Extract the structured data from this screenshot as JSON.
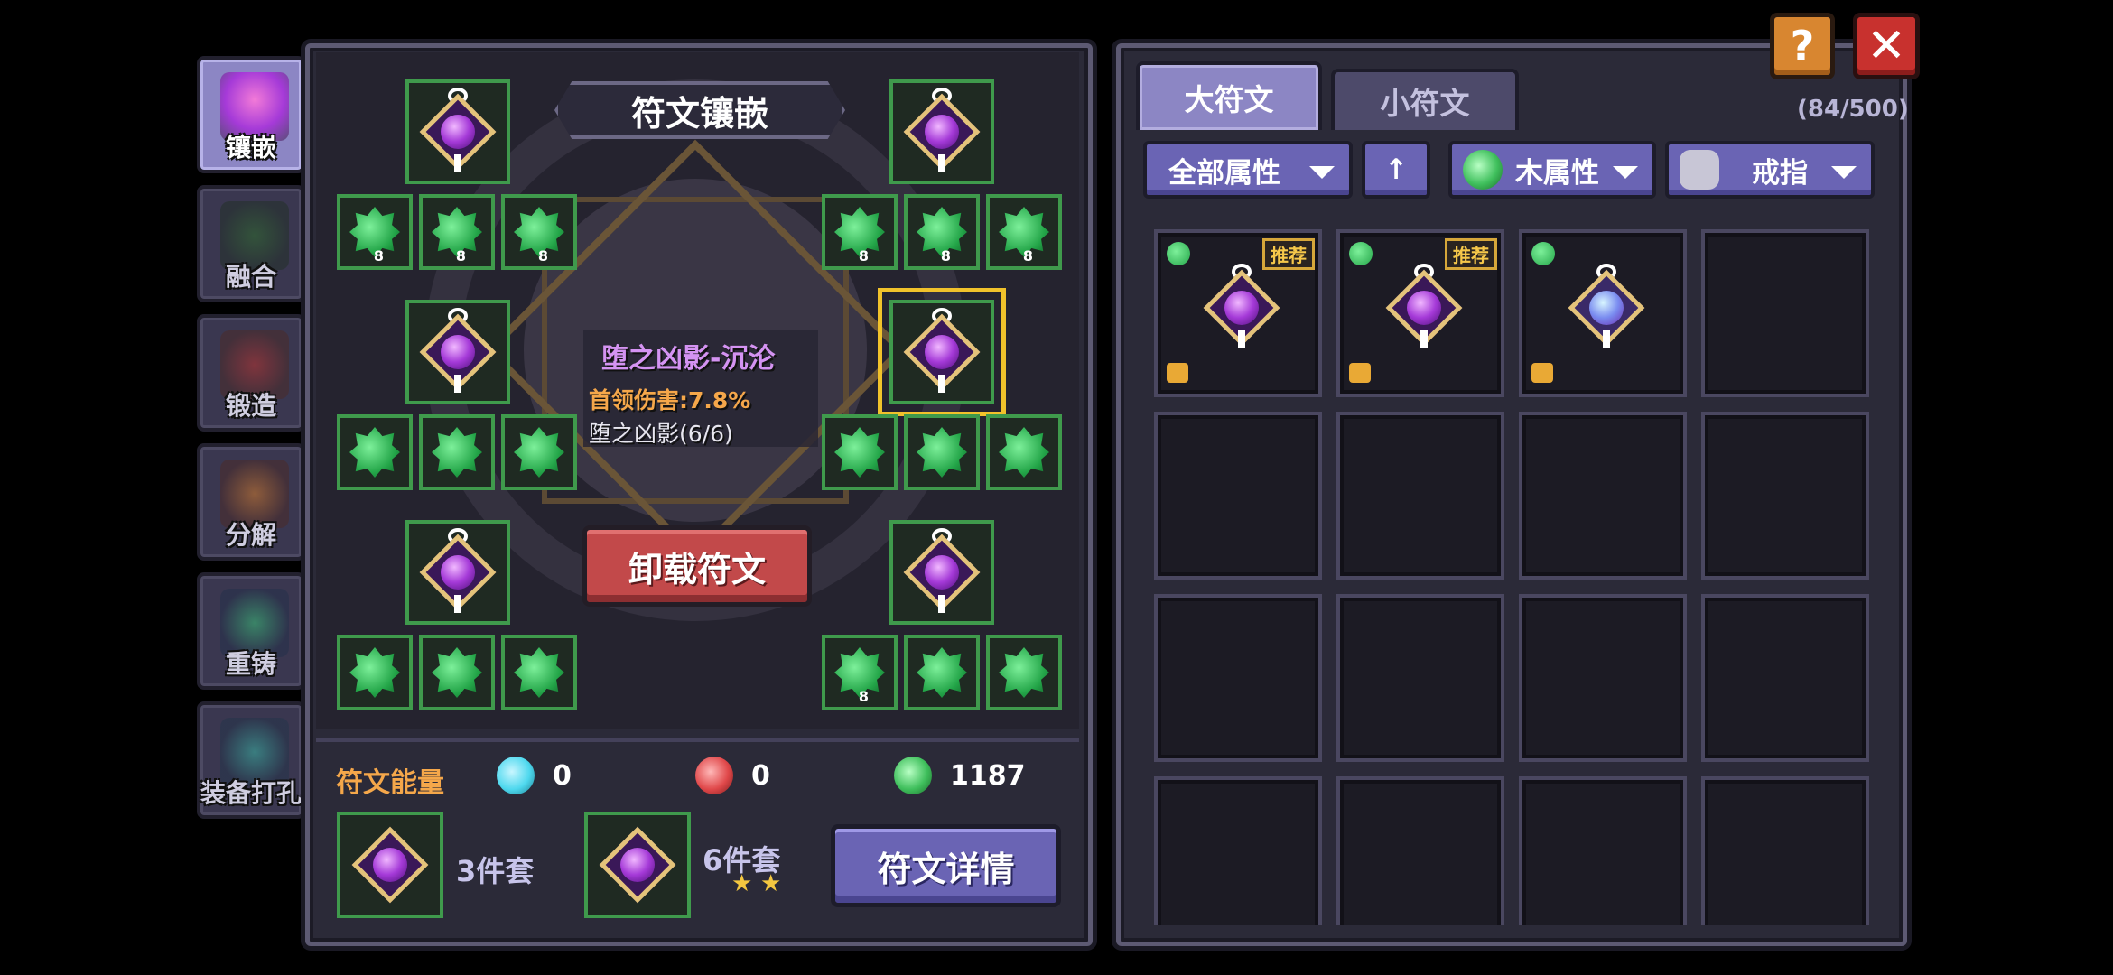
{
  "nav": [
    {
      "label": "镶嵌",
      "active": true
    },
    {
      "label": "融合"
    },
    {
      "label": "锻造"
    },
    {
      "label": "分解"
    },
    {
      "label": "重铸"
    },
    {
      "label": "装备打孔"
    }
  ],
  "board": {
    "title": "符文镶嵌",
    "info": {
      "name": "堕之凶影-沉沦",
      "stat": "首领伤害:7.8%",
      "set": "堕之凶影(6/6)"
    },
    "unload_button": "卸载符文",
    "small_rows": [
      [
        "8",
        "8",
        "8",
        "8",
        "8",
        "8"
      ],
      [
        "",
        "",
        "",
        "",
        "",
        ""
      ],
      [
        "",
        "",
        "",
        "8",
        "",
        ""
      ]
    ]
  },
  "energy": {
    "label": "符文能量",
    "values": [
      {
        "icon": "blue-crystal-icon",
        "value": "0",
        "color": "#4ed8ee"
      },
      {
        "icon": "red-flame-icon",
        "value": "0",
        "color": "#e0484a"
      },
      {
        "icon": "green-leaf-icon",
        "value": "1187",
        "color": "#3fbf5c"
      }
    ]
  },
  "sets": [
    {
      "label": "3件套"
    },
    {
      "label": "6件套",
      "stars": 2
    }
  ],
  "detail_button": "符文详情",
  "inventory": {
    "tabs": [
      {
        "label": "大符文",
        "active": true
      },
      {
        "label": "小符文",
        "active": false
      }
    ],
    "count": "(84/500)",
    "filters": [
      {
        "label": "全部属性"
      },
      {
        "label": "↑"
      },
      {
        "label": "木属性"
      },
      {
        "label": "戒指"
      }
    ],
    "items": [
      {
        "tag": "推荐",
        "locked": true,
        "variant": "purple"
      },
      {
        "tag": "推荐",
        "locked": true,
        "variant": "purple"
      },
      {
        "tag": "",
        "locked": true,
        "variant": "blue"
      }
    ]
  },
  "colors": {
    "accent_green": "#3f9a4c",
    "accent_purple": "#6a64b4",
    "accent_red": "#c2494a",
    "highlight_gold": "#f1c22b"
  },
  "top_buttons": {
    "help": "?",
    "close": "✕"
  }
}
